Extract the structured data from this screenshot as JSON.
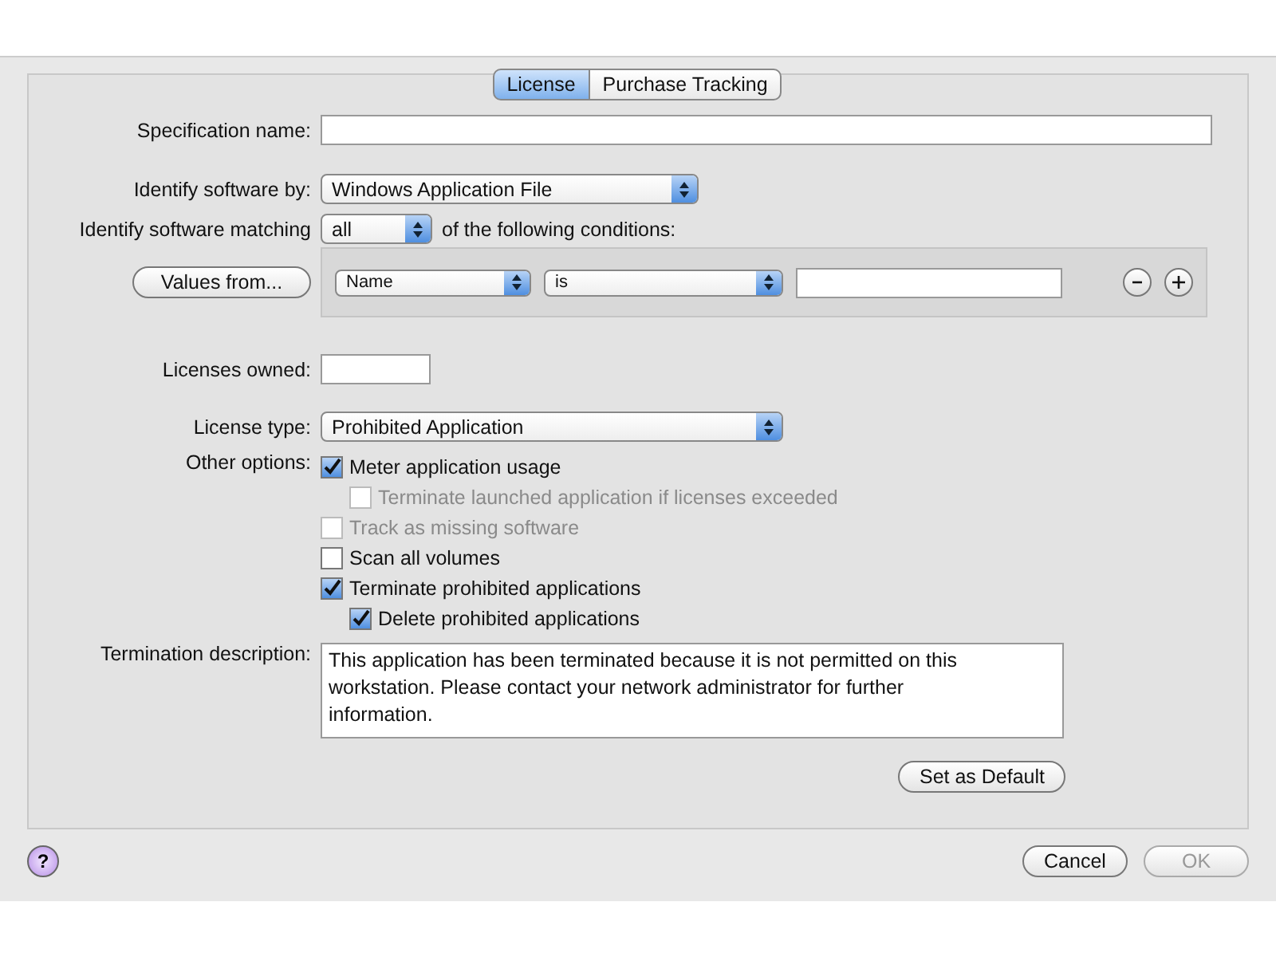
{
  "tabs": [
    {
      "label": "License",
      "selected": true
    },
    {
      "label": "Purchase Tracking",
      "selected": false
    }
  ],
  "specification_name": {
    "label": "Specification name:"
  },
  "identify_by": {
    "label": "Identify software by:",
    "value": "Windows Application File"
  },
  "matching": {
    "label": "Identify software matching",
    "value": "all",
    "suffix": "of the following conditions:"
  },
  "values_button": "Values from...",
  "condition": {
    "field": "Name",
    "operator": "is"
  },
  "licenses_owned": {
    "label": "Licenses owned:"
  },
  "license_type": {
    "label": "License type:",
    "value": "Prohibited Application"
  },
  "other_options": {
    "label": "Other options:",
    "options": [
      {
        "label": "Meter application usage",
        "checked": true,
        "disabled": false,
        "children": [
          {
            "label": "Terminate launched application if licenses exceeded",
            "checked": false,
            "disabled": true
          }
        ]
      },
      {
        "label": "Track as missing software",
        "checked": false,
        "disabled": true
      },
      {
        "label": "Scan all volumes",
        "checked": false,
        "disabled": false
      },
      {
        "label": "Terminate prohibited applications",
        "checked": true,
        "disabled": false,
        "children": [
          {
            "label": "Delete prohibited applications",
            "checked": true,
            "disabled": false
          }
        ]
      }
    ]
  },
  "termination_description": {
    "label": "Termination description:",
    "value": "This application has been terminated because it is not permitted on this workstation. Please contact your network administrator for further information."
  },
  "set_default": "Set as Default",
  "help": "?",
  "buttons": [
    {
      "label": "Cancel",
      "disabled": false
    },
    {
      "label": "OK",
      "disabled": true
    }
  ]
}
